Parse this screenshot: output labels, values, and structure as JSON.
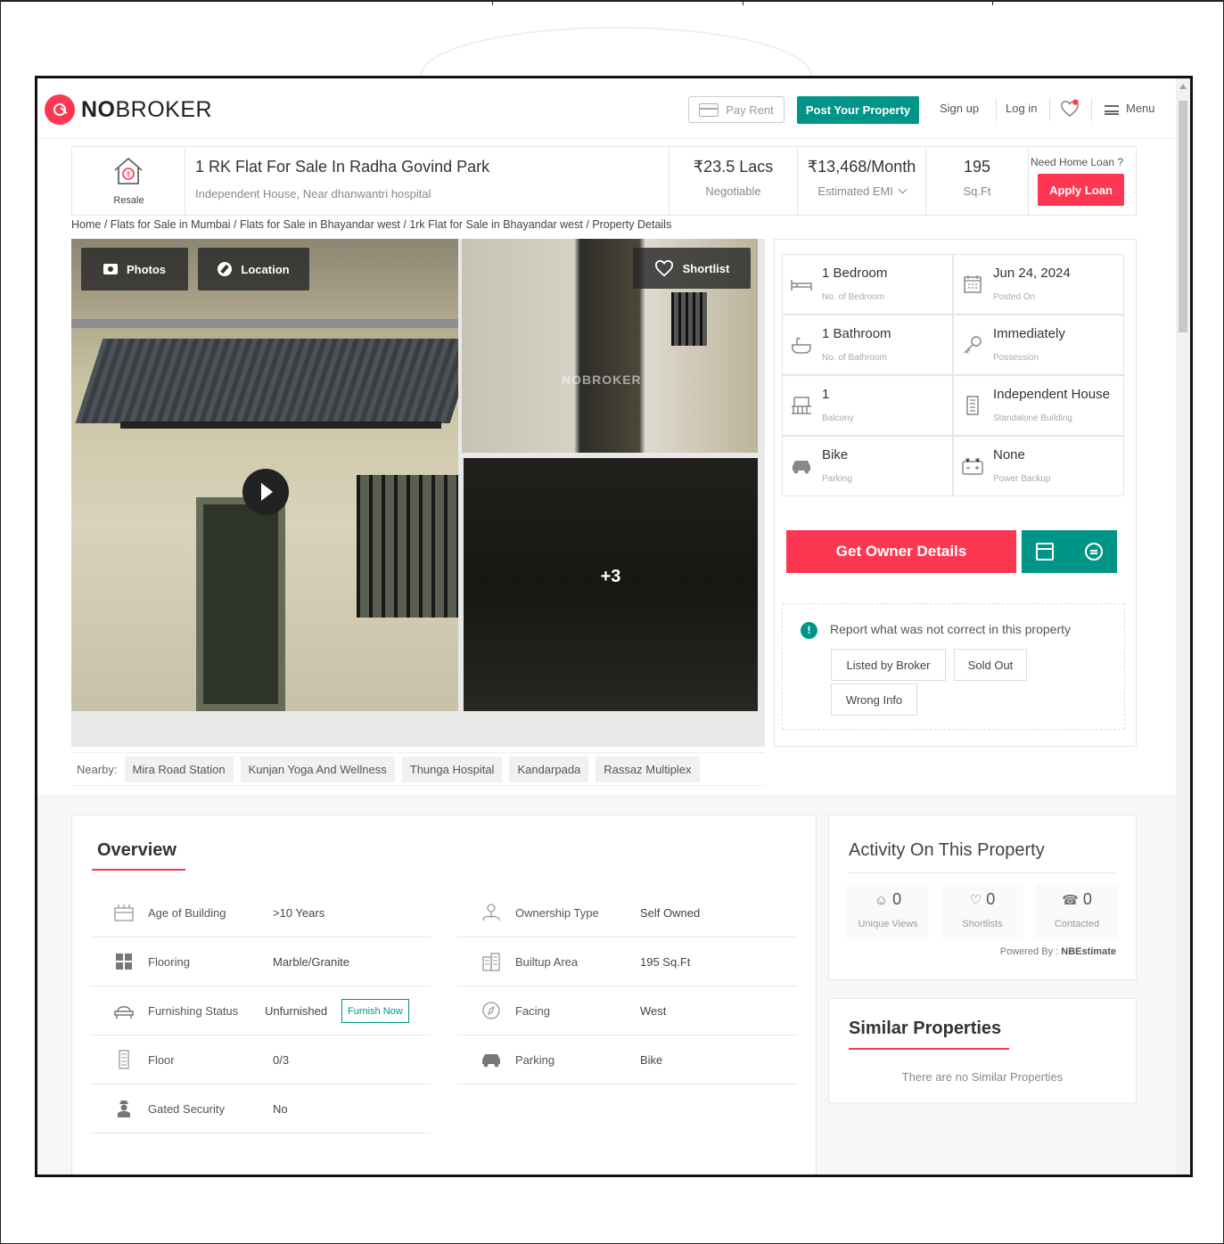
{
  "header": {
    "logo_bold": "NO",
    "logo_rest": "BROKER",
    "pay_rent": "Pay Rent",
    "post_property": "Post Your Property",
    "sign_up": "Sign up",
    "log_in": "Log in",
    "menu": "Menu"
  },
  "listing": {
    "badge": "Resale",
    "title": "1 RK Flat For Sale In Radha Govind Park",
    "subtitle": "Independent House, Near dhanwantri hospital",
    "price": "₹23.5 Lacs",
    "price_note": "Negotiable",
    "emi": "₹13,468/Month",
    "emi_note": "Estimated EMI",
    "area": "195",
    "area_unit": "Sq.Ft",
    "loan_question": "Need Home Loan ?",
    "apply_loan": "Apply Loan"
  },
  "breadcrumb": "Home / Flats for Sale in Mumbai / Flats for Sale in Bhayandar west / 1rk Flat for Sale in Bhayandar west / Property Details",
  "gallery": {
    "photos": "Photos",
    "location": "Location",
    "shortlist": "Shortlist",
    "watermark": "NOBROKER",
    "more": "+3"
  },
  "nearby": {
    "label": "Nearby:",
    "places": [
      "Mira Road Station",
      "Kunjan Yoga And Wellness",
      "Thunga Hospital",
      "Kandarpada",
      "Rassaz Multiplex"
    ]
  },
  "specs": [
    {
      "value": "1 Bedroom",
      "label": "No. of Bedroom",
      "icon": "bed-icon"
    },
    {
      "value": "Jun 24, 2024",
      "label": "Posted On",
      "icon": "calendar-icon"
    },
    {
      "value": "1 Bathroom",
      "label": "No. of Bathroom",
      "icon": "bath-icon"
    },
    {
      "value": "Immediately",
      "label": "Possession",
      "icon": "key-icon"
    },
    {
      "value": "1",
      "label": "Balcony",
      "icon": "balcony-icon"
    },
    {
      "value": "Independent House",
      "label": "Standalone Building",
      "icon": "building-icon"
    },
    {
      "value": "Bike",
      "label": "Parking",
      "icon": "car-icon"
    },
    {
      "value": "None",
      "label": "Power Backup",
      "icon": "battery-icon"
    }
  ],
  "actions": {
    "get_owner": "Get Owner Details"
  },
  "report": {
    "text": "Report what was not correct in this property",
    "buttons": [
      "Listed by Broker",
      "Sold Out",
      "Wrong Info"
    ]
  },
  "overview": {
    "title": "Overview",
    "left": [
      {
        "key": "Age of Building",
        "value": ">10 Years",
        "icon": "building-age-icon"
      },
      {
        "key": "Flooring",
        "value": "Marble/Granite",
        "icon": "flooring-icon"
      },
      {
        "key": "Furnishing Status",
        "value": "Unfurnished",
        "icon": "sofa-icon"
      },
      {
        "key": "Floor",
        "value": "0/3",
        "icon": "floor-icon"
      },
      {
        "key": "Gated Security",
        "value": "No",
        "icon": "security-icon"
      }
    ],
    "right": [
      {
        "key": "Ownership Type",
        "value": "Self Owned",
        "icon": "ownership-icon"
      },
      {
        "key": "Builtup Area",
        "value": "195 Sq.Ft",
        "icon": "area-icon"
      },
      {
        "key": "Facing",
        "value": "West",
        "icon": "compass-icon"
      },
      {
        "key": "Parking",
        "value": "Bike",
        "icon": "car-icon"
      }
    ],
    "furnish_now": "Furnish Now"
  },
  "activity": {
    "title": "Activity On This Property",
    "stats": [
      {
        "count": "0",
        "label": "Unique Views"
      },
      {
        "count": "0",
        "label": "Shortlists"
      },
      {
        "count": "0",
        "label": "Contacted"
      }
    ],
    "powered_label": "Powered By :",
    "powered_by": "NBEstimate"
  },
  "similar": {
    "title": "Similar Properties",
    "empty": "There are no Similar Properties"
  },
  "colors": {
    "brand_red": "#fd3752",
    "brand_teal": "#009587"
  }
}
